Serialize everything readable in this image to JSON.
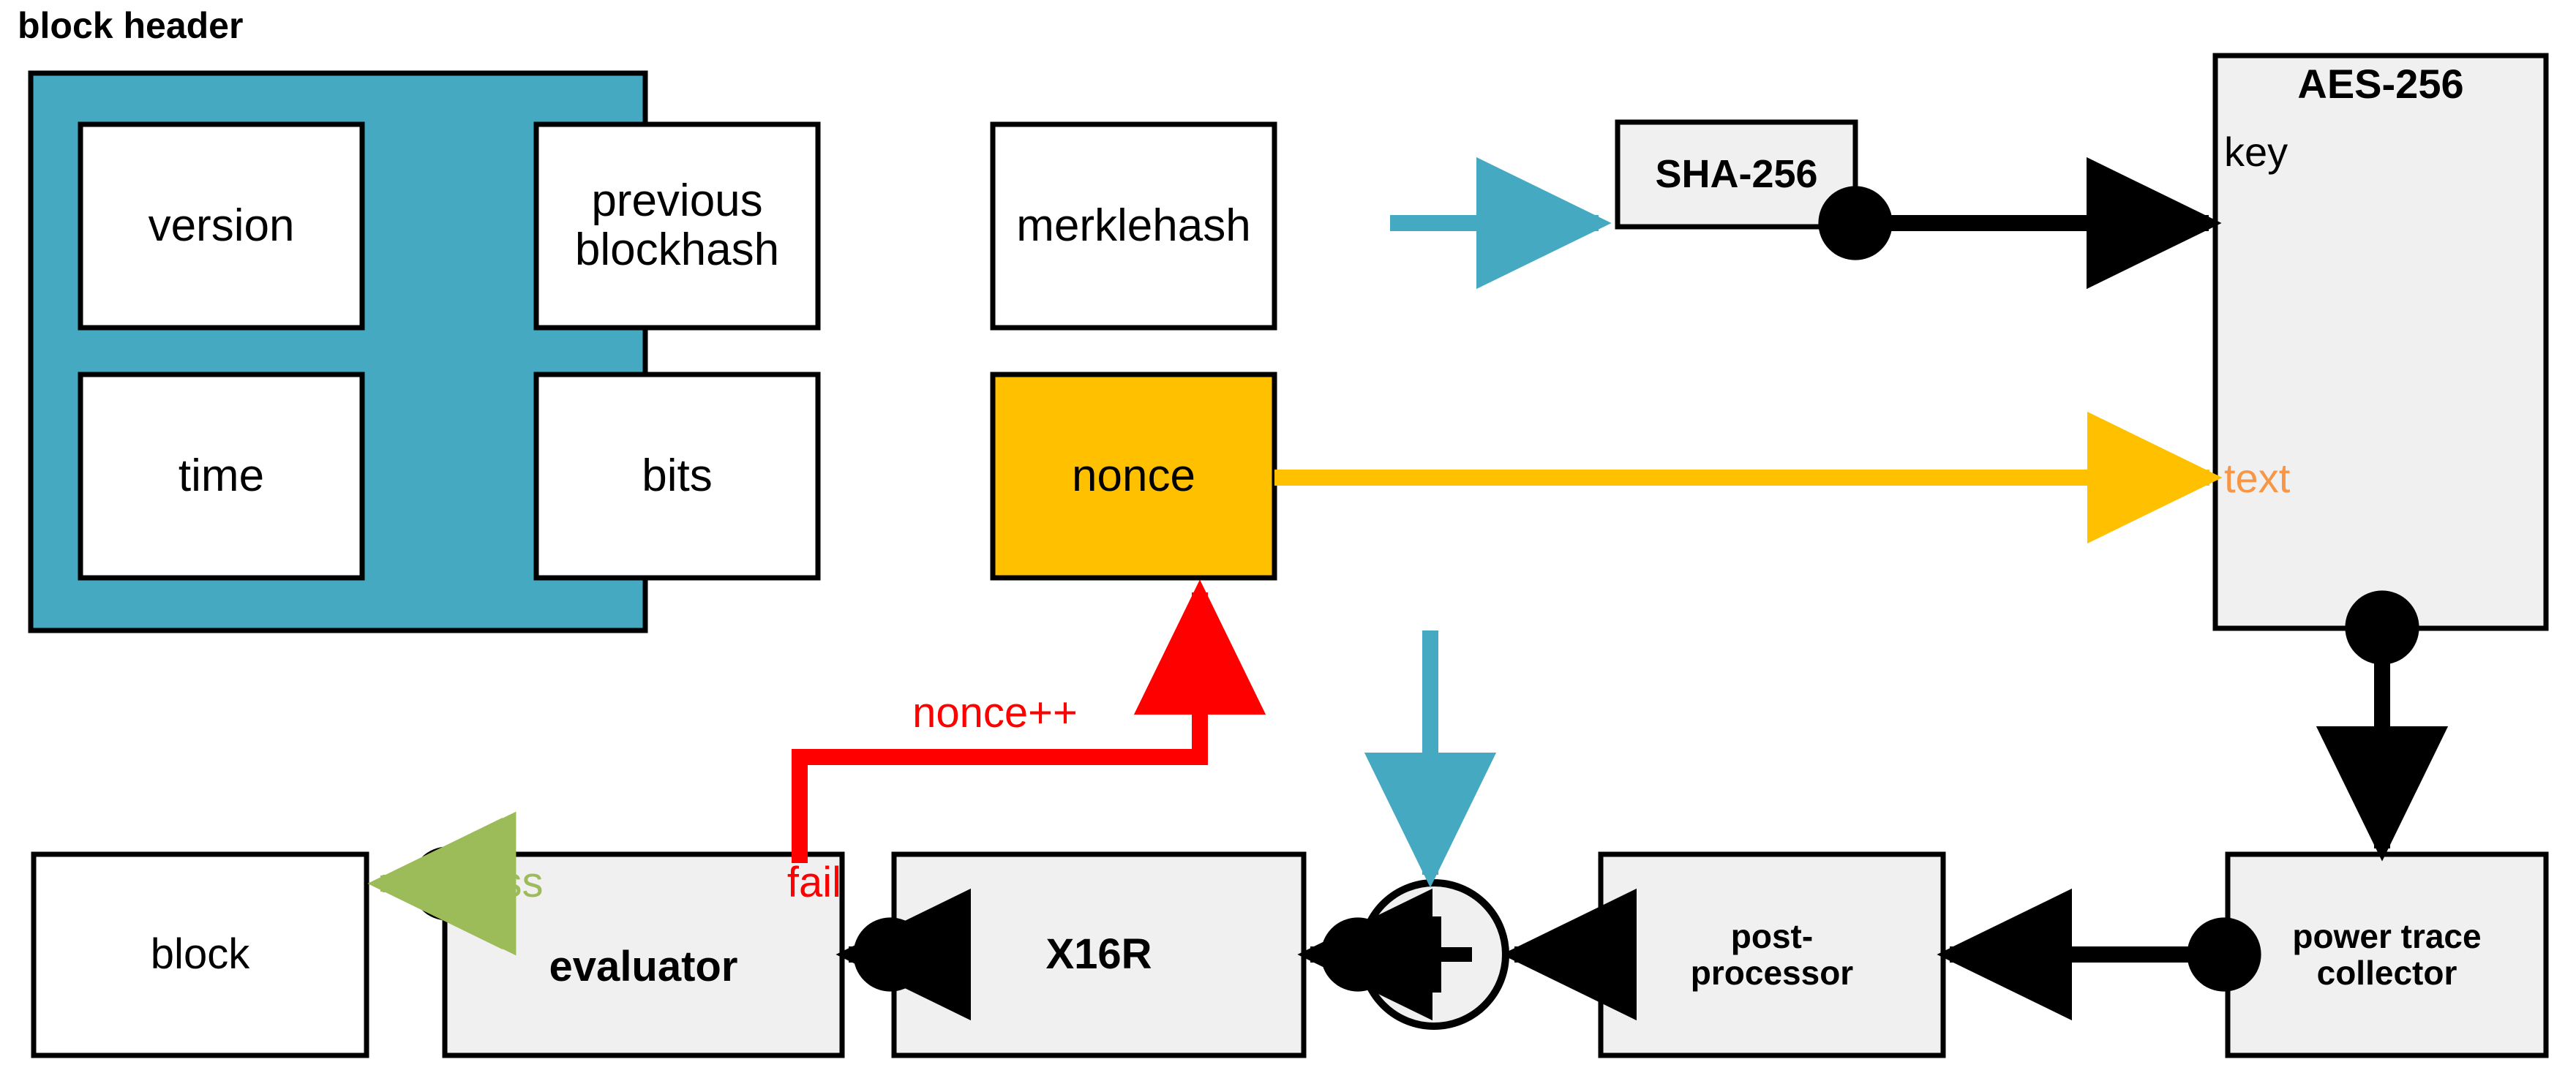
{
  "diagram": {
    "title": "block header",
    "colors": {
      "teal": "#45A9C1",
      "teal_stroke": "#3E9FB8",
      "yellow": "#FFC000",
      "gray_fill": "#F0F0F0",
      "white_fill": "#FFFFFF",
      "black": "#000000",
      "red": "#FF0000",
      "green": "#9CBB59",
      "salmon": "#F79646"
    }
  },
  "block_header": {
    "label": "block header",
    "fields": [
      {
        "id": "version",
        "label": "version",
        "fill": "white"
      },
      {
        "id": "previous-blockhash",
        "label": "previous\nblockhash",
        "fill": "white"
      },
      {
        "id": "merklehash",
        "label": "merklehash",
        "fill": "white"
      },
      {
        "id": "time",
        "label": "time",
        "fill": "white"
      },
      {
        "id": "bits",
        "label": "bits",
        "fill": "white"
      },
      {
        "id": "nonce",
        "label": "nonce",
        "fill": "yellow"
      }
    ]
  },
  "nodes": {
    "sha256": {
      "label": "SHA-256",
      "weight": "bold"
    },
    "aes256": {
      "title": "AES-256",
      "key_label": "key",
      "text_label": "text"
    },
    "power_trace_collector": {
      "label": "power trace\ncollector",
      "weight": "bold"
    },
    "post_processor": {
      "label": "post-\nprocessor",
      "weight": "bold"
    },
    "combiner": {
      "label": "+"
    },
    "x16r": {
      "label": "X16R",
      "weight": "bold"
    },
    "evaluator": {
      "label": "evaluator",
      "weight": "bold"
    },
    "block": {
      "label": "block",
      "weight": "normal"
    }
  },
  "edge_labels": {
    "nonce_increment": "nonce++",
    "fail": "fail",
    "pass": "pass"
  },
  "edges": [
    {
      "id": "merklehash-to-sha256",
      "from": "block-header",
      "to": "sha256",
      "color": "teal"
    },
    {
      "id": "sha256-to-aes256-key",
      "from": "sha256",
      "to": "aes256",
      "color": "black"
    },
    {
      "id": "nonce-to-aes256-text",
      "from": "nonce",
      "to": "aes256",
      "color": "yellow"
    },
    {
      "id": "aes256-to-power-trace-collector",
      "from": "aes256",
      "to": "power_trace_collector",
      "color": "black"
    },
    {
      "id": "power-trace-collector-to-post-processor",
      "from": "power_trace_collector",
      "to": "post_processor",
      "color": "black"
    },
    {
      "id": "post-processor-to-combiner",
      "from": "post_processor",
      "to": "combiner",
      "color": "black"
    },
    {
      "id": "block-header-to-combiner",
      "from": "block-header",
      "to": "combiner",
      "color": "teal"
    },
    {
      "id": "combiner-to-x16r",
      "from": "combiner",
      "to": "x16r",
      "color": "black"
    },
    {
      "id": "x16r-to-evaluator",
      "from": "x16r",
      "to": "evaluator",
      "color": "black"
    },
    {
      "id": "evaluator-fail-to-nonce",
      "from": "evaluator",
      "to": "nonce",
      "color": "red",
      "label": "nonce++"
    },
    {
      "id": "evaluator-pass-to-block",
      "from": "evaluator",
      "to": "block",
      "color": "green",
      "label": "pass"
    }
  ]
}
